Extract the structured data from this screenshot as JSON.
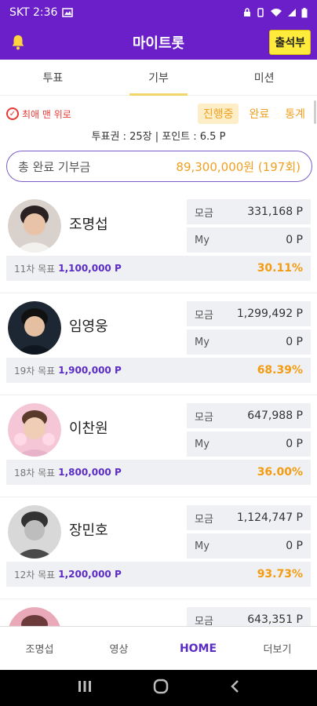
{
  "status": {
    "carrier_time": "SKT 2:36"
  },
  "app": {
    "title": "마이트롯",
    "checkin_label": "출석부"
  },
  "tabs": [
    {
      "label": "투표"
    },
    {
      "label": "기부"
    },
    {
      "label": "미션"
    }
  ],
  "filters": {
    "favorites_label": "최애 맨 위로",
    "segments": [
      {
        "label": "진행중"
      },
      {
        "label": "완료"
      },
      {
        "label": "통계"
      }
    ]
  },
  "summary": {
    "stats_text": "투표권 : 25장 | 포인트 : 6.5 P",
    "total_label": "총 완료 기부금",
    "total_amount": "89,300,000원 (197회)"
  },
  "labels": {
    "collected": "모금",
    "my": "My"
  },
  "cards": [
    {
      "name": "조명섭",
      "collected": "331,168 P",
      "my": "0 P",
      "goal_label": "11차 목표",
      "goal_amount": "1,100,000 P",
      "percent": "30.11%"
    },
    {
      "name": "임영웅",
      "collected": "1,299,492 P",
      "my": "0 P",
      "goal_label": "19차 목표",
      "goal_amount": "1,900,000 P",
      "percent": "68.39%"
    },
    {
      "name": "이찬원",
      "collected": "647,988 P",
      "my": "0 P",
      "goal_label": "18차 목표",
      "goal_amount": "1,800,000 P",
      "percent": "36.00%"
    },
    {
      "name": "장민호",
      "collected": "1,124,747 P",
      "my": "0 P",
      "goal_label": "12차 목표",
      "goal_amount": "1,200,000 P",
      "percent": "93.73%"
    },
    {
      "name": "",
      "collected": "643,351 P",
      "my": "",
      "goal_label": "",
      "goal_amount": "",
      "percent": ""
    }
  ],
  "bottom_nav": [
    {
      "label": "조명섭"
    },
    {
      "label": "영상"
    },
    {
      "label": "HOME"
    },
    {
      "label": "더보기"
    }
  ],
  "colors": {
    "brand": "#6a1fc8",
    "accent": "#f39c12",
    "goal_amount": "#5b2cc4",
    "checkin": "#ffeb3b"
  },
  "icons": {
    "bell": "bell-icon",
    "check": "check-circle-icon"
  }
}
